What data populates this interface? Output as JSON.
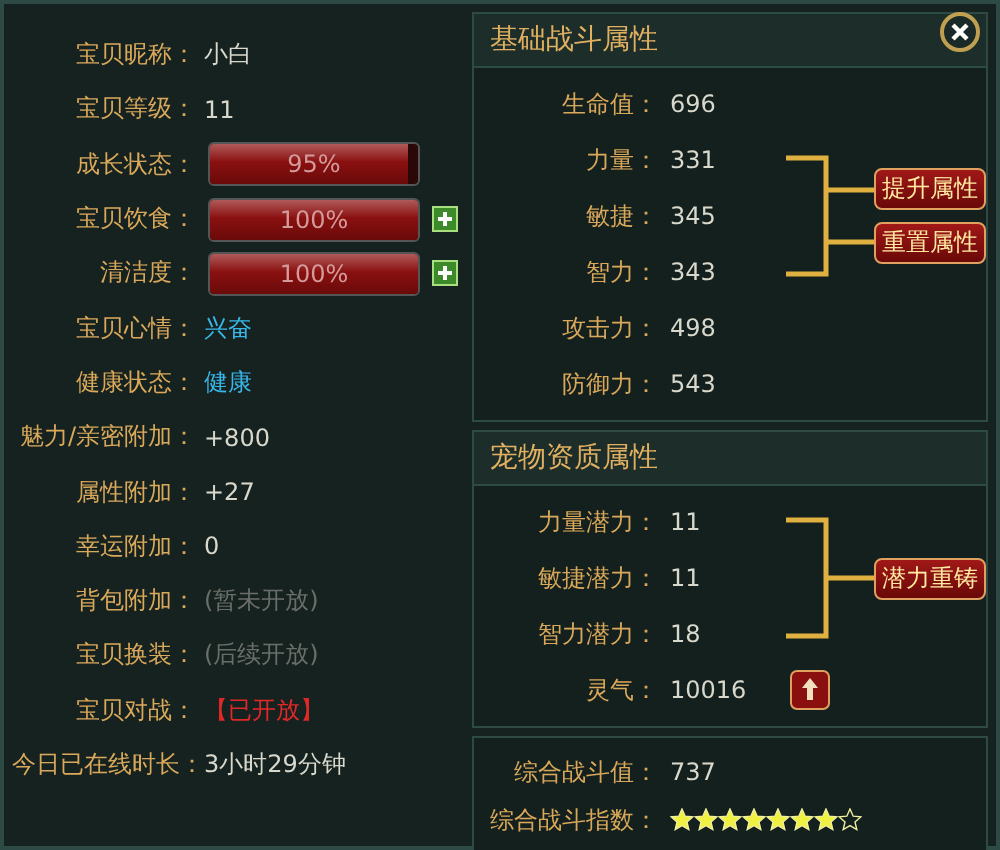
{
  "pet_info": [
    {
      "label": "宝贝昵称：",
      "kind": "text",
      "value": "小白"
    },
    {
      "label": "宝贝等级：",
      "kind": "text",
      "value": "11"
    },
    {
      "label": "成长状态：",
      "kind": "bar",
      "level": 0.95,
      "reading": "95%",
      "addable": false
    },
    {
      "label": "宝贝饮食：",
      "kind": "bar",
      "level": 1,
      "reading": "100%",
      "addable": true
    },
    {
      "label": "清洁度：",
      "kind": "bar",
      "level": 1,
      "reading": "100%",
      "addable": true
    },
    {
      "label": "宝贝心情：",
      "kind": "highlight",
      "value": "兴奋"
    },
    {
      "label": "健康状态：",
      "kind": "highlight",
      "value": "健康"
    },
    {
      "label": "魅力/亲密附加：",
      "kind": "text",
      "value": "+800"
    },
    {
      "label": "属性附加：",
      "kind": "text",
      "value": "+27"
    },
    {
      "label": "幸运附加：",
      "kind": "text",
      "value": "0"
    },
    {
      "label": "背包附加：",
      "kind": "disabled",
      "value": "(暂未开放)"
    },
    {
      "label": "宝贝换装：",
      "kind": "disabled",
      "value": "(后续开放)"
    },
    {
      "label": "宝贝对战：",
      "kind": "alert",
      "value": "【已开放】"
    },
    {
      "label": "今日已在线时长：",
      "kind": "text",
      "value": "3小时29分钟"
    }
  ],
  "combat": {
    "title": "基础战斗属性",
    "top": [
      {
        "label": "生命值：",
        "value": "696"
      }
    ],
    "group": [
      {
        "label": "力量：",
        "value": "331"
      },
      {
        "label": "敏捷：",
        "value": "345"
      },
      {
        "label": "智力：",
        "value": "343"
      }
    ],
    "buttons": [
      "提升属性",
      "重置属性"
    ],
    "bottom": [
      {
        "label": "攻击力：",
        "value": "498"
      },
      {
        "label": "防御力：",
        "value": "543"
      }
    ]
  },
  "aptitude": {
    "title": "宠物资质属性",
    "group": [
      {
        "label": "力量潜力：",
        "value": "11"
      },
      {
        "label": "敏捷潜力：",
        "value": "11"
      },
      {
        "label": "智力潜力：",
        "value": "18"
      }
    ],
    "buttons": [
      "潜力重铸"
    ],
    "spirit": {
      "label": "灵气：",
      "value": "10016"
    }
  },
  "summary": {
    "power_label": "综合战斗值：",
    "power_value": "737",
    "index_label": "综合战斗指数：",
    "stars": 7
  }
}
